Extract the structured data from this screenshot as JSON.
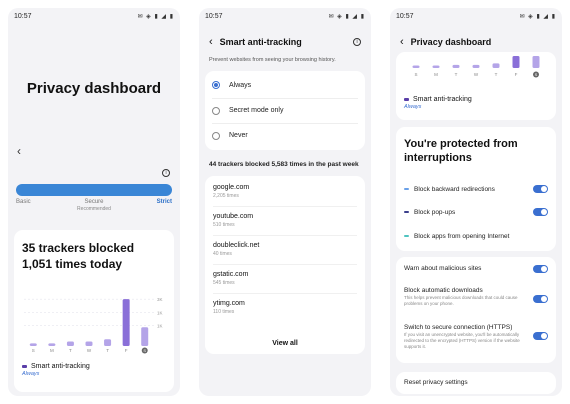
{
  "status": {
    "time": "10:57",
    "icons": "✉ ◈ ▮ ◢ ▮"
  },
  "screen1": {
    "title": "Privacy dashboard",
    "levels": [
      {
        "label": "Basic",
        "sub": ""
      },
      {
        "label": "Secure",
        "sub": "Recommended"
      },
      {
        "label": "Strict",
        "sub": ""
      }
    ],
    "trackers_title": "35 trackers blocked 1,051 times today",
    "anti_tracking": {
      "label": "Smart anti-tracking",
      "status": "Always"
    }
  },
  "screen2": {
    "title": "Smart anti-tracking",
    "description": "Prevent websites from seeing your browsing history.",
    "options": [
      {
        "label": "Always",
        "selected": true
      },
      {
        "label": "Secret mode only",
        "selected": false
      },
      {
        "label": "Never",
        "selected": false
      }
    ],
    "summary": "44 trackers blocked 5,583 times in the past week",
    "sites": [
      {
        "name": "google.com",
        "times": "2,205 times"
      },
      {
        "name": "youtube.com",
        "times": "510 times"
      },
      {
        "name": "doubleclick.net",
        "times": "40 times"
      },
      {
        "name": "gstatic.com",
        "times": "545 times"
      },
      {
        "name": "ytimg.com",
        "times": "110 times"
      }
    ],
    "view_all": "View all"
  },
  "screen3": {
    "title": "Privacy dashboard",
    "anti_tracking": {
      "label": "Smart anti-tracking",
      "status": "Always"
    },
    "protected_title": "You're protected from interruptions",
    "blocks": [
      {
        "label": "Block backward redirections",
        "color": "#6aa0e8",
        "toggle": true
      },
      {
        "label": "Block pop-ups",
        "color": "#3b3f8c",
        "toggle": true
      },
      {
        "label": "Block apps from opening Internet",
        "color": "#4fc3c0",
        "toggle": null
      }
    ],
    "settings": [
      {
        "title": "Warn about malicious sites",
        "desc": "",
        "toggle": true
      },
      {
        "title": "Block automatic downloads",
        "desc": "This helps prevent malicious downloads that could cause problems on your phone.",
        "toggle": true
      },
      {
        "title": "Switch to secure connection (HTTPS)",
        "desc": "If you visit an unencrypted website, you'll be automatically redirected to the encrypted (HTTPS) version if the website supports it.",
        "toggle": true
      }
    ],
    "reset": "Reset privacy settings"
  },
  "chart_data": {
    "type": "bar",
    "categories": [
      "S",
      "M",
      "T",
      "W",
      "T",
      "F",
      "S"
    ],
    "values": [
      60,
      60,
      100,
      100,
      150,
      1051,
      420
    ],
    "ytick_labels": [
      "3K",
      "1K",
      "1K"
    ],
    "ylim": [
      0,
      1300
    ],
    "accent_color": "#8a6fd8"
  }
}
